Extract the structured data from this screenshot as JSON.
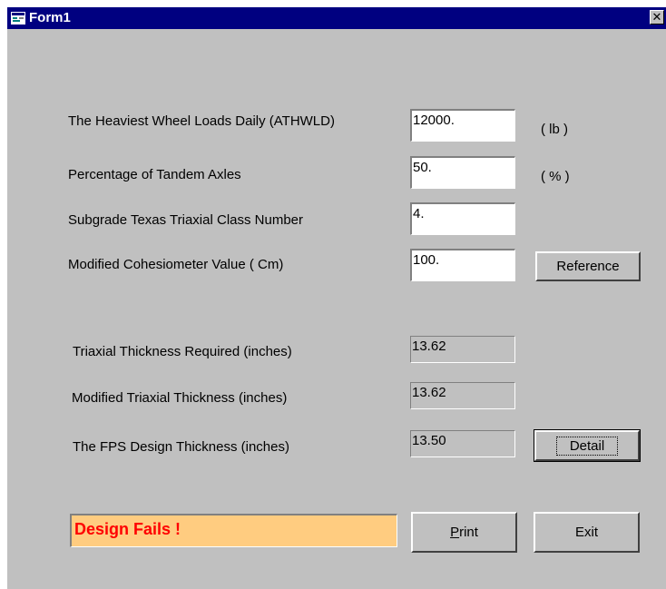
{
  "window": {
    "title": "Form1",
    "close_glyph": "✕"
  },
  "inputs": [
    {
      "label": "The Heaviest Wheel Loads Daily  (ATHWLD)",
      "value": "12000.",
      "unit": "( lb )"
    },
    {
      "label": "Percentage of Tandem Axles",
      "value": "50.",
      "unit": "( % )"
    },
    {
      "label": "Subgrade  Texas  Triaxial Class Number",
      "value": "4.",
      "unit": ""
    },
    {
      "label": "Modified  Cohesiometer   Value  ( Cm)",
      "value": "100.",
      "unit": ""
    }
  ],
  "reference_button": "Reference",
  "results": [
    {
      "label": "Triaxial Thickness Required  (inches)",
      "value": "13.62"
    },
    {
      "label": "Modified Triaxial  Thickness   (inches)",
      "value": "13.62"
    },
    {
      "label": "The FPS Design Thickness   (inches)",
      "value": "13.50"
    }
  ],
  "detail_button": "Detail",
  "status": {
    "text": "Design Fails !",
    "color": "#ff0000",
    "background": "#ffcc80"
  },
  "print_button": {
    "label_rest": "rint",
    "label_mnemonic": "P"
  },
  "exit_button": "Exit",
  "colors": {
    "titlebar": "#000080",
    "window_face": "#c0c0c0"
  },
  "icons": {
    "app": "form-window-icon",
    "close": "close-icon"
  }
}
